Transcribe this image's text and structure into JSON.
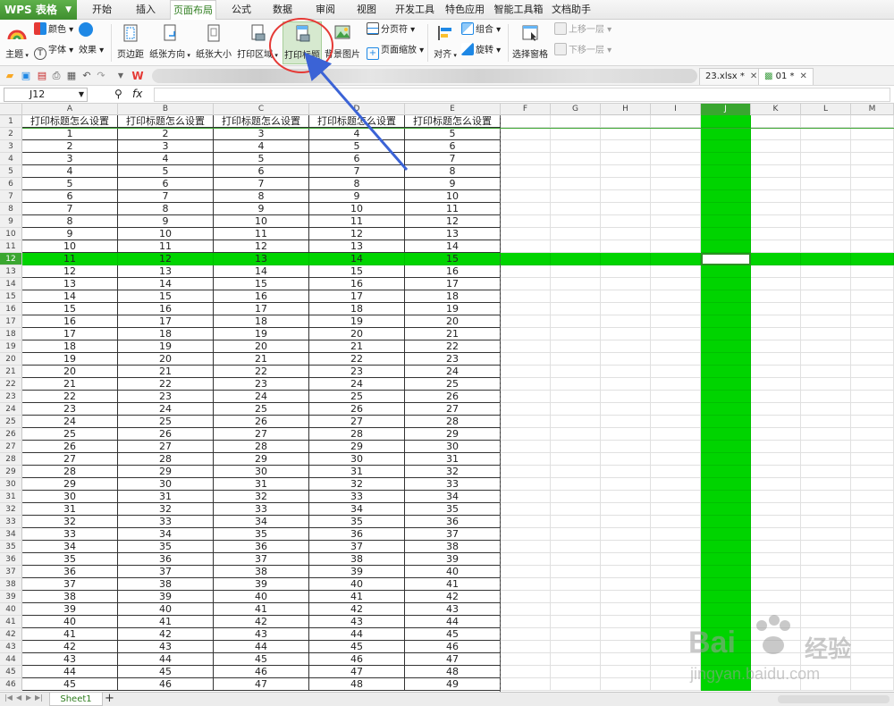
{
  "app": {
    "name": "WPS 表格"
  },
  "menu": {
    "tabs": [
      "开始",
      "插入",
      "页面布局",
      "公式",
      "数据",
      "审阅",
      "视图",
      "开发工具",
      "特色应用",
      "智能工具箱",
      "文档助手"
    ],
    "active": "页面布局"
  },
  "ribbon": {
    "color_label": "颜色",
    "theme_label": "主题",
    "font_label": "字体",
    "effect_label": "效果",
    "margin_label": "页边距",
    "orientation_label": "纸张方向",
    "size_label": "纸张大小",
    "print_area_label": "打印区域",
    "print_titles_label": "打印标题",
    "background_label": "背景图片",
    "page_break_label": "分页符",
    "page_zoom_label": "页面缩放",
    "align_label": "对齐",
    "group_label": "组合",
    "rotate_label": "旋转",
    "selection_pane_label": "选择窗格",
    "bring_forward_label": "上移一层",
    "send_backward_label": "下移一层"
  },
  "doc_tabs": [
    {
      "label": "23.xlsx *",
      "active": false
    },
    {
      "label": "01 *",
      "active": true
    }
  ],
  "formula_bar": {
    "cell_ref": "J12",
    "fx": "fx",
    "value": ""
  },
  "columns": [
    "A",
    "B",
    "C",
    "D",
    "E",
    "F",
    "G",
    "H",
    "I",
    "J",
    "K",
    "L",
    "M"
  ],
  "selected_column": "J",
  "selected_row": 12,
  "header_row": [
    "打印标题怎么设置",
    "打印标题怎么设置",
    "打印标题怎么设置",
    "打印标题怎么设置",
    "打印标题怎么设置"
  ],
  "row_numbers": [
    1,
    2,
    3,
    4,
    5,
    6,
    7,
    8,
    9,
    10,
    11,
    12,
    13,
    14,
    15,
    16,
    17,
    18,
    19,
    20,
    21,
    22,
    23,
    24,
    25,
    26,
    27,
    28,
    29,
    30,
    31,
    32,
    33,
    34,
    35,
    36,
    37,
    38,
    39,
    40,
    41,
    42,
    43,
    44,
    45,
    46
  ],
  "data_rows": [
    [
      1,
      2,
      3,
      4,
      5
    ],
    [
      2,
      3,
      4,
      5,
      6
    ],
    [
      3,
      4,
      5,
      6,
      7
    ],
    [
      4,
      5,
      6,
      7,
      8
    ],
    [
      5,
      6,
      7,
      8,
      9
    ],
    [
      6,
      7,
      8,
      9,
      10
    ],
    [
      7,
      8,
      9,
      10,
      11
    ],
    [
      8,
      9,
      10,
      11,
      12
    ],
    [
      9,
      10,
      11,
      12,
      13
    ],
    [
      10,
      11,
      12,
      13,
      14
    ],
    [
      11,
      12,
      13,
      14,
      15
    ],
    [
      12,
      13,
      14,
      15,
      16
    ],
    [
      13,
      14,
      15,
      16,
      17
    ],
    [
      14,
      15,
      16,
      17,
      18
    ],
    [
      15,
      16,
      17,
      18,
      19
    ],
    [
      16,
      17,
      18,
      19,
      20
    ],
    [
      17,
      18,
      19,
      20,
      21
    ],
    [
      18,
      19,
      20,
      21,
      22
    ],
    [
      19,
      20,
      21,
      22,
      23
    ],
    [
      20,
      21,
      22,
      23,
      24
    ],
    [
      21,
      22,
      23,
      24,
      25
    ],
    [
      22,
      23,
      24,
      25,
      26
    ],
    [
      23,
      24,
      25,
      26,
      27
    ],
    [
      24,
      25,
      26,
      27,
      28
    ],
    [
      25,
      26,
      27,
      28,
      29
    ],
    [
      26,
      27,
      28,
      29,
      30
    ],
    [
      27,
      28,
      29,
      30,
      31
    ],
    [
      28,
      29,
      30,
      31,
      32
    ],
    [
      29,
      30,
      31,
      32,
      33
    ],
    [
      30,
      31,
      32,
      33,
      34
    ],
    [
      31,
      32,
      33,
      34,
      35
    ],
    [
      32,
      33,
      34,
      35,
      36
    ],
    [
      33,
      34,
      35,
      36,
      37
    ],
    [
      34,
      35,
      36,
      37,
      38
    ],
    [
      35,
      36,
      37,
      38,
      39
    ],
    [
      36,
      37,
      38,
      39,
      40
    ],
    [
      37,
      38,
      39,
      40,
      41
    ],
    [
      38,
      39,
      40,
      41,
      42
    ],
    [
      39,
      40,
      41,
      42,
      43
    ],
    [
      40,
      41,
      42,
      43,
      44
    ],
    [
      41,
      42,
      43,
      44,
      45
    ],
    [
      42,
      43,
      44,
      45,
      46
    ],
    [
      43,
      44,
      45,
      46,
      47
    ],
    [
      44,
      45,
      46,
      47,
      48
    ],
    [
      45,
      46,
      47,
      48,
      49
    ]
  ],
  "sheets": [
    "Sheet1"
  ],
  "colors": {
    "accent": "#3aa630",
    "highlight": "#00d400",
    "annotation": "#e53935",
    "arrow": "#3b63d6"
  },
  "icons": [
    "theme-icon",
    "color-icon",
    "font-icon",
    "effect-icon",
    "margin-icon",
    "orientation-icon",
    "paper-size-icon",
    "print-area-icon",
    "print-titles-icon",
    "background-icon",
    "page-break-icon",
    "page-zoom-icon",
    "align-icon",
    "group-icon",
    "rotate-icon",
    "selection-pane-icon",
    "open-icon",
    "save-icon",
    "print-icon",
    "undo-icon",
    "redo-icon",
    "zoom-icon"
  ],
  "watermark": {
    "brand": "Bai",
    "brand_cn": "经验",
    "url": "jingyan.baidu.com"
  }
}
